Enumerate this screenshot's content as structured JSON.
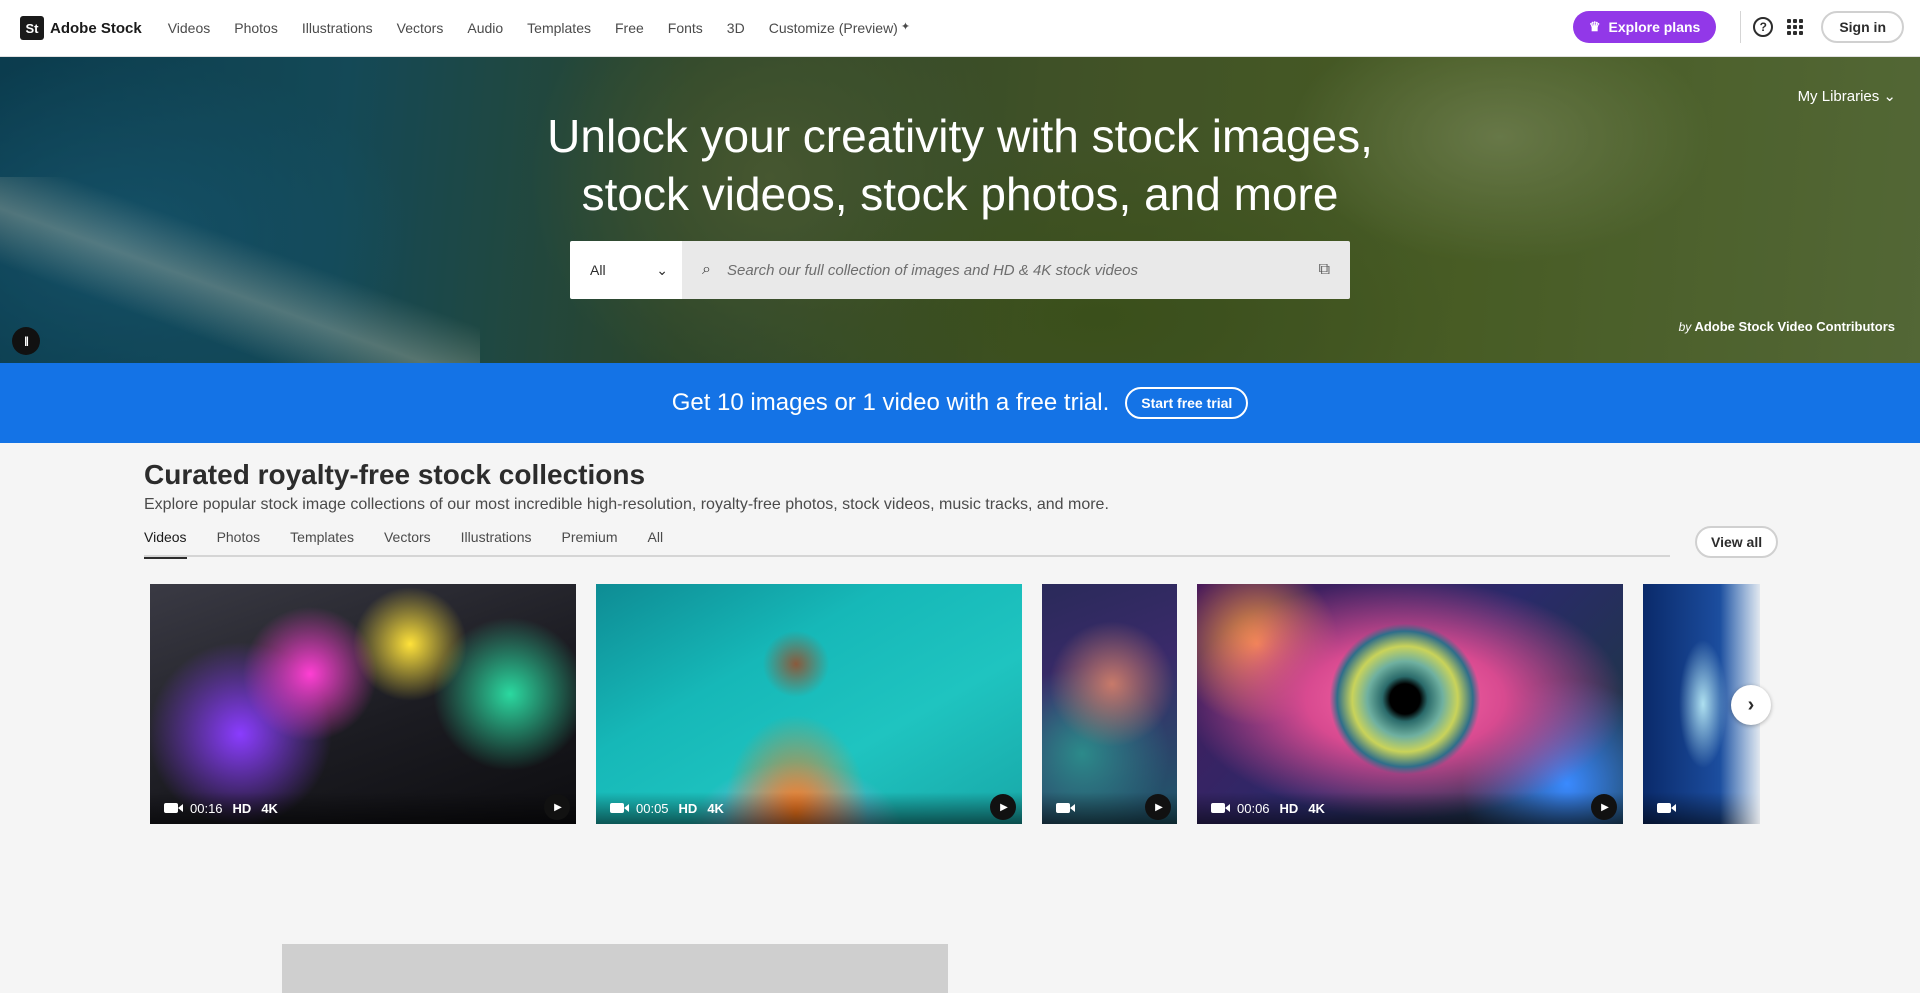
{
  "nav": {
    "logo_text": "St",
    "brand": "Adobe Stock",
    "items": [
      "Videos",
      "Photos",
      "Illustrations",
      "Vectors",
      "Audio",
      "Templates",
      "Free",
      "Fonts",
      "3D",
      "Customize (Preview)"
    ],
    "explore_label": "Explore plans",
    "help_icon": "help-icon",
    "signin_label": "Sign in",
    "accent": "#9238e8"
  },
  "hero": {
    "title_line1": "Unlock your creativity with stock images,",
    "title_line2": "stock videos, stock photos, and more",
    "scope_value": "All",
    "search_placeholder": "Search our full collection of images and HD & 4K stock videos",
    "my_libraries": "My Libraries",
    "credit_by": "by",
    "credit_name": "Adobe Stock Video Contributors"
  },
  "promo": {
    "text": "Get 10 images or 1 video with a free trial.",
    "button": "Start free trial",
    "color": "#1473e6"
  },
  "collections": {
    "title": "Curated royalty-free stock collections",
    "description": "Explore popular stock image collections of our most incredible high-resolution, royalty-free photos, stock videos, music tracks, and more.",
    "tabs": [
      "Videos",
      "Photos",
      "Templates",
      "Vectors",
      "Illustrations",
      "Premium",
      "All"
    ],
    "active_tab": "Videos",
    "view_all": "View all",
    "cards": [
      {
        "duration": "00:16",
        "hd": "HD",
        "k4": "4K"
      },
      {
        "duration": "00:05",
        "hd": "HD",
        "k4": "4K"
      },
      {
        "duration": "",
        "hd": "",
        "k4": ""
      },
      {
        "duration": "00:06",
        "hd": "HD",
        "k4": "4K"
      },
      {
        "duration": "",
        "hd": "",
        "k4": ""
      }
    ]
  }
}
